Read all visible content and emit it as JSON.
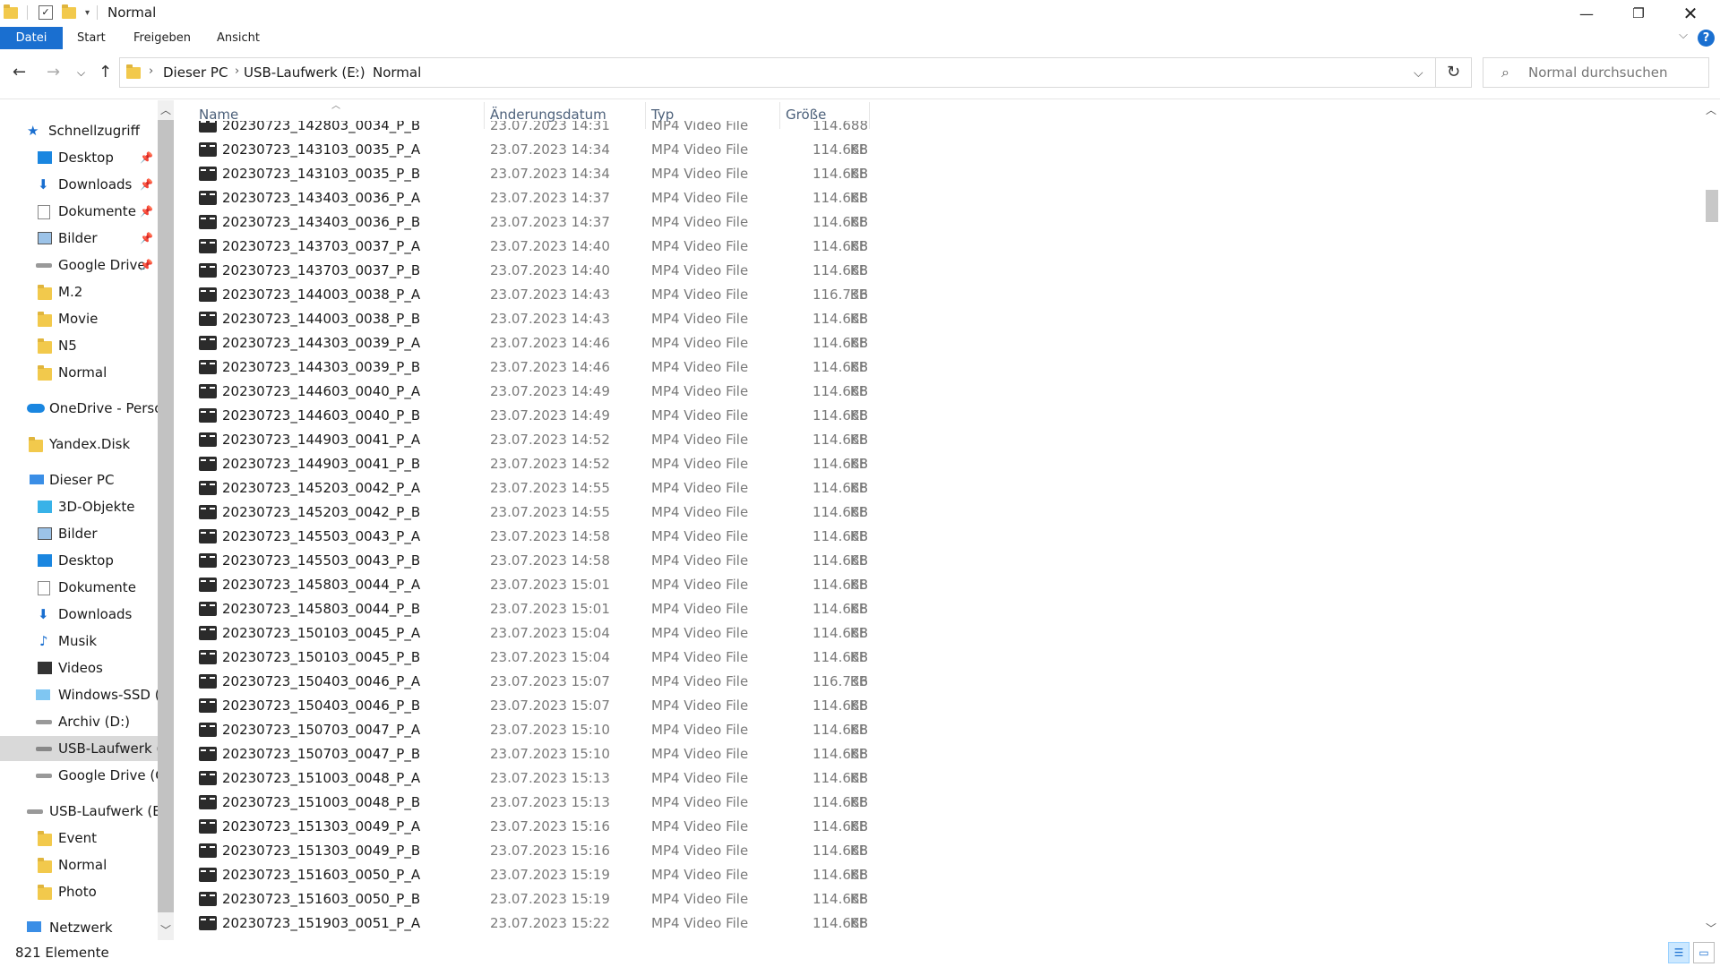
{
  "window": {
    "title": "Normal",
    "minimize_icon": "minimize-icon",
    "maximize_icon": "restore-icon",
    "close_icon": "close-icon"
  },
  "ribbon": {
    "tabs": [
      {
        "label": "Datei",
        "active": true
      },
      {
        "label": "Start"
      },
      {
        "label": "Freigeben"
      },
      {
        "label": "Ansicht"
      }
    ],
    "help_label": "?"
  },
  "breadcrumb": [
    "Dieser PC",
    "USB-Laufwerk (E:)",
    "Normal"
  ],
  "search": {
    "placeholder": "Normal durchsuchen"
  },
  "navigation": {
    "quick_access": "Schnellzugriff",
    "items": [
      {
        "label": "Desktop",
        "pinned": true
      },
      {
        "label": "Downloads",
        "pinned": true
      },
      {
        "label": "Dokumente",
        "pinned": true
      },
      {
        "label": "Bilder",
        "pinned": true
      },
      {
        "label": "Google Drive",
        "pinned": true
      },
      {
        "label": "M.2"
      },
      {
        "label": "Movie"
      },
      {
        "label": "N5"
      },
      {
        "label": "Normal"
      }
    ],
    "onedrive": "OneDrive - Person",
    "yandex": "Yandex.Disk",
    "this_pc": "Dieser PC",
    "pc_items": [
      {
        "label": "3D-Objekte"
      },
      {
        "label": "Bilder"
      },
      {
        "label": "Desktop"
      },
      {
        "label": "Dokumente"
      },
      {
        "label": "Downloads"
      },
      {
        "label": "Musik"
      },
      {
        "label": "Videos"
      },
      {
        "label": "Windows-SSD (C"
      },
      {
        "label": "Archiv (D:)"
      },
      {
        "label": "USB-Laufwerk (E"
      },
      {
        "label": "Google Drive (G:"
      }
    ],
    "usb": "USB-Laufwerk (E:)",
    "usb_items": [
      {
        "label": "Event"
      },
      {
        "label": "Normal"
      },
      {
        "label": "Photo"
      }
    ],
    "network": "Netzwerk"
  },
  "columns": {
    "name": "Name",
    "date": "Änderungsdatum",
    "type": "Typ",
    "size": "Größe"
  },
  "files": [
    {
      "name": "20230723_142803_0034_P_B",
      "date": "23.07.2023 14:31",
      "type": "MP4 Video File",
      "size": "114.688 KB"
    },
    {
      "name": "20230723_143103_0035_P_A",
      "date": "23.07.2023 14:34",
      "type": "MP4 Video File",
      "size": "114.688 KB"
    },
    {
      "name": "20230723_143103_0035_P_B",
      "date": "23.07.2023 14:34",
      "type": "MP4 Video File",
      "size": "114.688 KB"
    },
    {
      "name": "20230723_143403_0036_P_A",
      "date": "23.07.2023 14:37",
      "type": "MP4 Video File",
      "size": "114.688 KB"
    },
    {
      "name": "20230723_143403_0036_P_B",
      "date": "23.07.2023 14:37",
      "type": "MP4 Video File",
      "size": "114.688 KB"
    },
    {
      "name": "20230723_143703_0037_P_A",
      "date": "23.07.2023 14:40",
      "type": "MP4 Video File",
      "size": "114.688 KB"
    },
    {
      "name": "20230723_143703_0037_P_B",
      "date": "23.07.2023 14:40",
      "type": "MP4 Video File",
      "size": "114.688 KB"
    },
    {
      "name": "20230723_144003_0038_P_A",
      "date": "23.07.2023 14:43",
      "type": "MP4 Video File",
      "size": "116.736 KB"
    },
    {
      "name": "20230723_144003_0038_P_B",
      "date": "23.07.2023 14:43",
      "type": "MP4 Video File",
      "size": "114.688 KB"
    },
    {
      "name": "20230723_144303_0039_P_A",
      "date": "23.07.2023 14:46",
      "type": "MP4 Video File",
      "size": "114.688 KB"
    },
    {
      "name": "20230723_144303_0039_P_B",
      "date": "23.07.2023 14:46",
      "type": "MP4 Video File",
      "size": "114.688 KB"
    },
    {
      "name": "20230723_144603_0040_P_A",
      "date": "23.07.2023 14:49",
      "type": "MP4 Video File",
      "size": "114.688 KB"
    },
    {
      "name": "20230723_144603_0040_P_B",
      "date": "23.07.2023 14:49",
      "type": "MP4 Video File",
      "size": "114.688 KB"
    },
    {
      "name": "20230723_144903_0041_P_A",
      "date": "23.07.2023 14:52",
      "type": "MP4 Video File",
      "size": "114.688 KB"
    },
    {
      "name": "20230723_144903_0041_P_B",
      "date": "23.07.2023 14:52",
      "type": "MP4 Video File",
      "size": "114.688 KB"
    },
    {
      "name": "20230723_145203_0042_P_A",
      "date": "23.07.2023 14:55",
      "type": "MP4 Video File",
      "size": "114.688 KB"
    },
    {
      "name": "20230723_145203_0042_P_B",
      "date": "23.07.2023 14:55",
      "type": "MP4 Video File",
      "size": "114.688 KB"
    },
    {
      "name": "20230723_145503_0043_P_A",
      "date": "23.07.2023 14:58",
      "type": "MP4 Video File",
      "size": "114.688 KB"
    },
    {
      "name": "20230723_145503_0043_P_B",
      "date": "23.07.2023 14:58",
      "type": "MP4 Video File",
      "size": "114.688 KB"
    },
    {
      "name": "20230723_145803_0044_P_A",
      "date": "23.07.2023 15:01",
      "type": "MP4 Video File",
      "size": "114.688 KB"
    },
    {
      "name": "20230723_145803_0044_P_B",
      "date": "23.07.2023 15:01",
      "type": "MP4 Video File",
      "size": "114.688 KB"
    },
    {
      "name": "20230723_150103_0045_P_A",
      "date": "23.07.2023 15:04",
      "type": "MP4 Video File",
      "size": "114.688 KB"
    },
    {
      "name": "20230723_150103_0045_P_B",
      "date": "23.07.2023 15:04",
      "type": "MP4 Video File",
      "size": "114.688 KB"
    },
    {
      "name": "20230723_150403_0046_P_A",
      "date": "23.07.2023 15:07",
      "type": "MP4 Video File",
      "size": "116.736 KB"
    },
    {
      "name": "20230723_150403_0046_P_B",
      "date": "23.07.2023 15:07",
      "type": "MP4 Video File",
      "size": "114.688 KB"
    },
    {
      "name": "20230723_150703_0047_P_A",
      "date": "23.07.2023 15:10",
      "type": "MP4 Video File",
      "size": "114.688 KB"
    },
    {
      "name": "20230723_150703_0047_P_B",
      "date": "23.07.2023 15:10",
      "type": "MP4 Video File",
      "size": "114.688 KB"
    },
    {
      "name": "20230723_151003_0048_P_A",
      "date": "23.07.2023 15:13",
      "type": "MP4 Video File",
      "size": "114.688 KB"
    },
    {
      "name": "20230723_151003_0048_P_B",
      "date": "23.07.2023 15:13",
      "type": "MP4 Video File",
      "size": "114.688 KB"
    },
    {
      "name": "20230723_151303_0049_P_A",
      "date": "23.07.2023 15:16",
      "type": "MP4 Video File",
      "size": "114.688 KB"
    },
    {
      "name": "20230723_151303_0049_P_B",
      "date": "23.07.2023 15:16",
      "type": "MP4 Video File",
      "size": "114.688 KB"
    },
    {
      "name": "20230723_151603_0050_P_A",
      "date": "23.07.2023 15:19",
      "type": "MP4 Video File",
      "size": "114.688 KB"
    },
    {
      "name": "20230723_151603_0050_P_B",
      "date": "23.07.2023 15:19",
      "type": "MP4 Video File",
      "size": "114.688 KB"
    },
    {
      "name": "20230723_151903_0051_P_A",
      "date": "23.07.2023 15:22",
      "type": "MP4 Video File",
      "size": "114.688 KB"
    }
  ],
  "status": {
    "count": "821 Elemente"
  },
  "colors": {
    "accent": "#1a6fd0",
    "selected": "#d9d9d9",
    "header_text": "#4c607a",
    "meta_text": "#7a7a7a"
  }
}
